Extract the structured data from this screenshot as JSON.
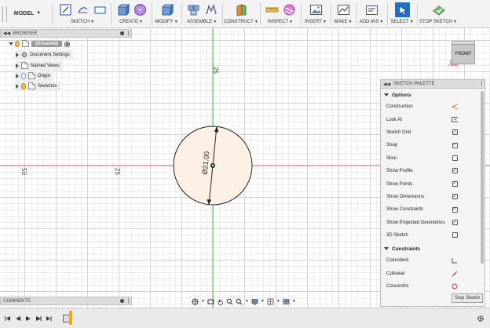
{
  "toolbar": {
    "model_label": "MODEL",
    "groups": [
      {
        "label": "SKETCH"
      },
      {
        "label": "CREATE"
      },
      {
        "label": "MODIFY"
      },
      {
        "label": "ASSEMBLE"
      },
      {
        "label": "CONSTRUCT"
      },
      {
        "label": "INSPECT"
      },
      {
        "label": "INSERT"
      },
      {
        "label": "MAKE"
      },
      {
        "label": "ADD-INS"
      },
      {
        "label": "SELECT"
      },
      {
        "label": "STOP SKETCH"
      }
    ]
  },
  "browser": {
    "title": "BROWSER",
    "root_label": "(Unsaved)",
    "items": [
      {
        "label": "Document Settings"
      },
      {
        "label": "Named Views"
      },
      {
        "label": "Origin"
      },
      {
        "label": "Sketches"
      }
    ]
  },
  "viewcube": {
    "face_label": "FRONT",
    "axis_x": "x",
    "axis_z": "z"
  },
  "canvas": {
    "dimension_label": "Ø21.00",
    "ruler_top": "25",
    "ruler_left_far": "50",
    "ruler_left_near": "25",
    "sketch_fill": "#fdf1e6",
    "axis_green": "#4cc44c",
    "axis_red": "#e07070"
  },
  "palette": {
    "title": "SKETCH PALETTE",
    "sections": {
      "options": "Options",
      "constraints": "Constraints"
    },
    "options": [
      {
        "label": "Construction",
        "control": "construction-icon"
      },
      {
        "label": "Look At",
        "control": "look-at-icon"
      },
      {
        "label": "Sketch Grid",
        "control": "checkbox",
        "checked": true
      },
      {
        "label": "Snap",
        "control": "checkbox",
        "checked": true
      },
      {
        "label": "Slice",
        "control": "checkbox",
        "checked": false
      },
      {
        "label": "Show Profile",
        "control": "checkbox",
        "checked": true
      },
      {
        "label": "Show Points",
        "control": "checkbox",
        "checked": true
      },
      {
        "label": "Show Dimensions",
        "control": "checkbox",
        "checked": true
      },
      {
        "label": "Show Constraints",
        "control": "checkbox",
        "checked": true
      },
      {
        "label": "Show Projected Geometries",
        "control": "checkbox",
        "checked": true
      },
      {
        "label": "3D Sketch",
        "control": "checkbox",
        "checked": false
      }
    ],
    "constraints": [
      {
        "label": "Coincident"
      },
      {
        "label": "Collinear"
      },
      {
        "label": "Concentric"
      }
    ],
    "stop_button": "Stop Sketch"
  },
  "comments": {
    "title": "COMMENTS"
  },
  "checkmark": "✓"
}
